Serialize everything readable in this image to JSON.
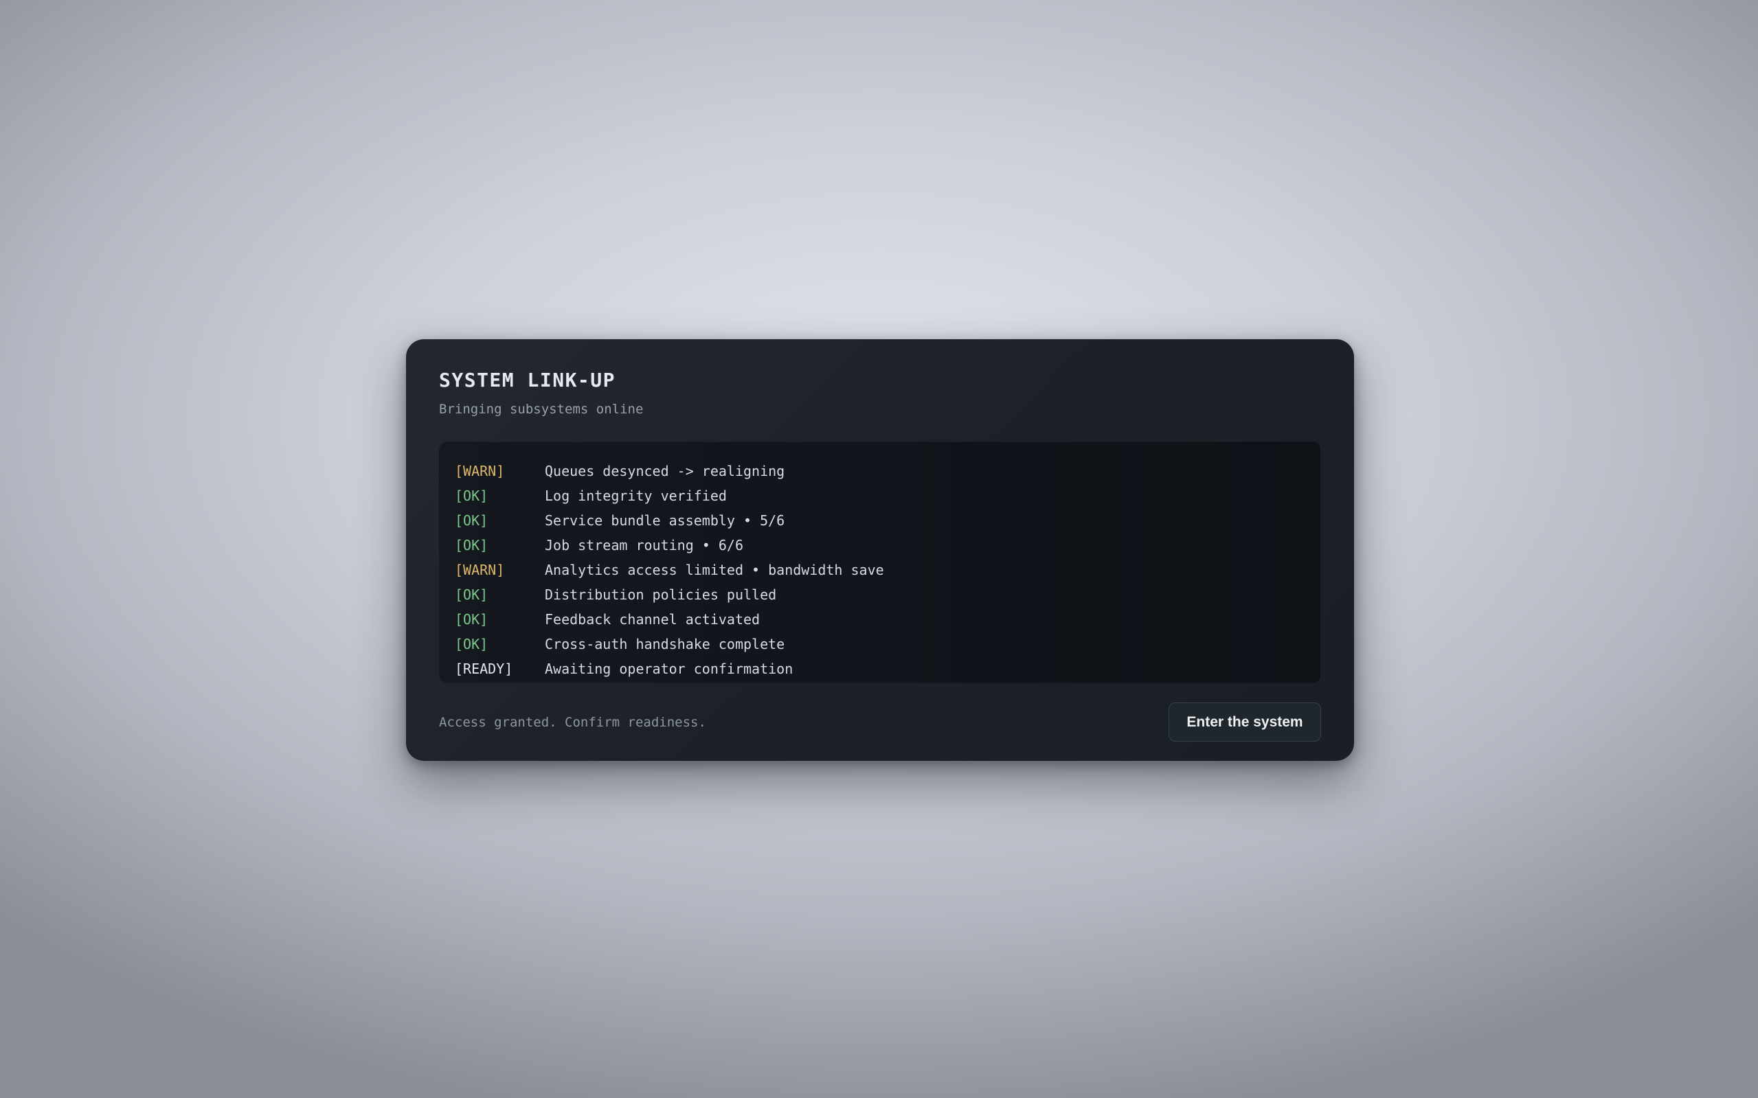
{
  "panel": {
    "title": "SYSTEM LINK-UP",
    "subtitle": "Bringing subsystems online"
  },
  "log": [
    {
      "tag": "[WARN]",
      "level": "warn",
      "message": "Queues desynced -> realigning"
    },
    {
      "tag": "[OK]",
      "level": "ok",
      "message": "Log integrity verified"
    },
    {
      "tag": "[OK]",
      "level": "ok",
      "message": "Service bundle assembly • 5/6"
    },
    {
      "tag": "[OK]",
      "level": "ok",
      "message": "Job stream routing • 6/6"
    },
    {
      "tag": "[WARN]",
      "level": "warn",
      "message": "Analytics access limited • bandwidth save"
    },
    {
      "tag": "[OK]",
      "level": "ok",
      "message": "Distribution policies pulled"
    },
    {
      "tag": "[OK]",
      "level": "ok",
      "message": "Feedback channel activated"
    },
    {
      "tag": "[OK]",
      "level": "ok",
      "message": "Cross-auth handshake complete"
    },
    {
      "tag": "[READY]",
      "level": "ready",
      "message": "Awaiting operator confirmation"
    }
  ],
  "footer": {
    "status": "Access granted. Confirm readiness.",
    "enter_label": "Enter the system"
  },
  "colors": {
    "warn": "#e0b76a",
    "ok": "#7bc98a",
    "ready": "#e3e6ea"
  }
}
